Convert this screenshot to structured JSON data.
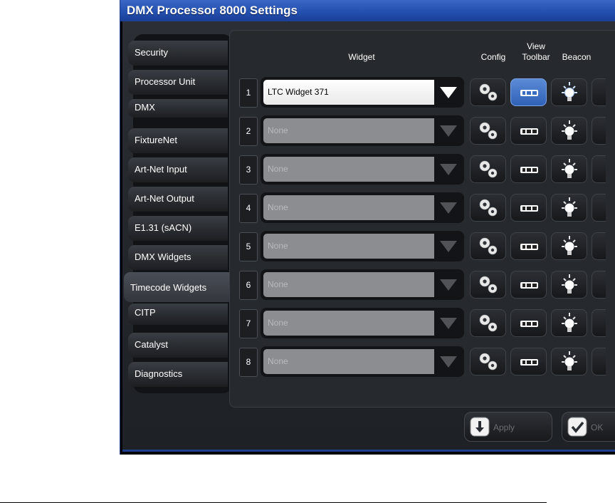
{
  "window": {
    "title": "DMX Processor 8000 Settings"
  },
  "tabs": [
    {
      "label": "Security"
    },
    {
      "label": "Processor Unit"
    },
    {
      "label": "DMX"
    },
    {
      "label": "FixtureNet"
    },
    {
      "label": "Art-Net Input"
    },
    {
      "label": "Art-Net Output"
    },
    {
      "label": "E1.31 (sACN)"
    },
    {
      "label": "DMX Widgets"
    },
    {
      "label": "Timecode Widgets",
      "selected": true
    },
    {
      "label": "CITP"
    },
    {
      "label": "Catalyst"
    },
    {
      "label": "Diagnostics"
    }
  ],
  "columns": {
    "widget": "Widget",
    "config": "Config",
    "view_toolbar_line1": "View",
    "view_toolbar_line2": "Toolbar",
    "beacon": "Beacon"
  },
  "rows": [
    {
      "num": "1",
      "value": "LTC Widget 371",
      "active": true
    },
    {
      "num": "2",
      "value": "None",
      "active": false
    },
    {
      "num": "3",
      "value": "None",
      "active": false
    },
    {
      "num": "4",
      "value": "None",
      "active": false
    },
    {
      "num": "5",
      "value": "None",
      "active": false
    },
    {
      "num": "6",
      "value": "None",
      "active": false
    },
    {
      "num": "7",
      "value": "None",
      "active": false
    },
    {
      "num": "8",
      "value": "None",
      "active": false
    }
  ],
  "footer": {
    "apply_label": "Apply",
    "ok_label": "OK"
  },
  "colors": {
    "title_bar": "#2450b0",
    "active_toolbar_button": "#3a6cc4",
    "background": "#24272c"
  },
  "icons": {
    "config": "gears-icon",
    "view_toolbar": "toolbar-icon",
    "beacon": "lightbulb-icon",
    "apply": "apply-icon",
    "ok": "checkmark-icon"
  }
}
